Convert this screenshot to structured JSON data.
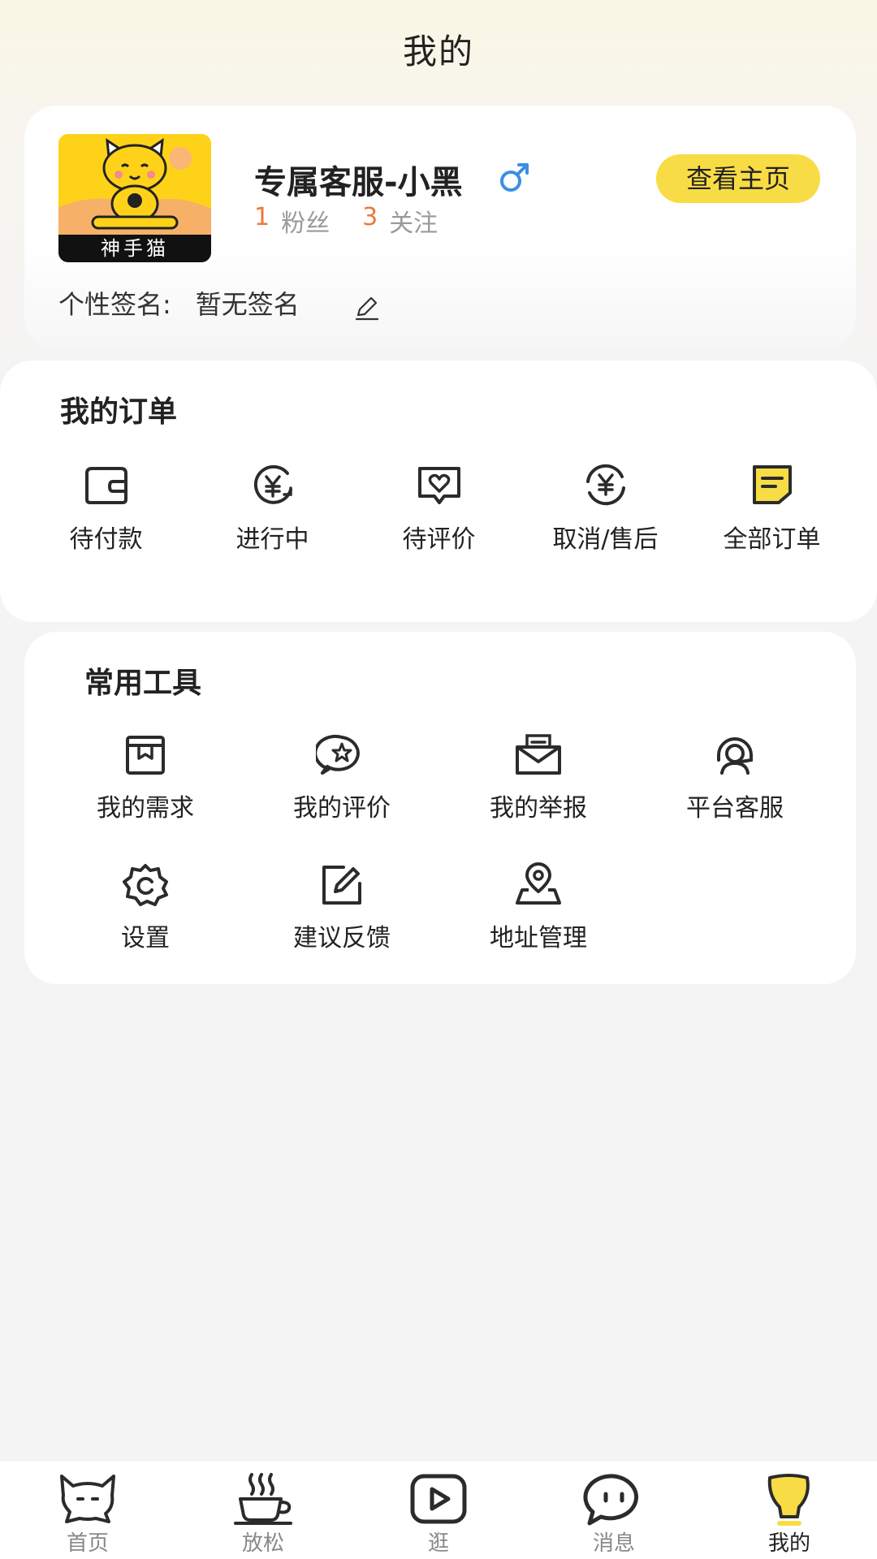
{
  "header": {
    "title": "我的"
  },
  "profile": {
    "avatar_caption": "神手猫",
    "nickname": "专属客服-小黑",
    "fans_count": "1",
    "fans_label": "粉丝",
    "follow_count": "3",
    "follow_label": "关注",
    "homepage_button": "查看主页",
    "signature_label": "个性签名:",
    "signature_value": "暂无签名",
    "colors": {
      "accent": "#f8dc45",
      "count": "#e87a3c",
      "gender": "#3b8fe0"
    }
  },
  "orders": {
    "title": "我的订单",
    "items": [
      {
        "label": "待付款",
        "icon": "wallet-icon"
      },
      {
        "label": "进行中",
        "icon": "yuan-refresh-icon"
      },
      {
        "label": "待评价",
        "icon": "heart-chat-icon"
      },
      {
        "label": "取消/售后",
        "icon": "yuan-exchange-icon"
      },
      {
        "label": "全部订单",
        "icon": "order-list-icon"
      }
    ]
  },
  "tools": {
    "title": "常用工具",
    "items": [
      {
        "label": "我的需求",
        "icon": "archive-box-icon"
      },
      {
        "label": "我的评价",
        "icon": "star-chat-icon"
      },
      {
        "label": "我的举报",
        "icon": "envelope-icon"
      },
      {
        "label": "平台客服",
        "icon": "headset-icon"
      },
      {
        "label": "设置",
        "icon": "gear-icon"
      },
      {
        "label": "建议反馈",
        "icon": "edit-square-icon"
      },
      {
        "label": "地址管理",
        "icon": "map-pin-icon"
      }
    ]
  },
  "tabbar": {
    "items": [
      {
        "label": "首页",
        "icon": "cat-icon",
        "active": false
      },
      {
        "label": "放松",
        "icon": "coffee-cup-icon",
        "active": false
      },
      {
        "label": "逛",
        "icon": "play-icon",
        "active": false
      },
      {
        "label": "消息",
        "icon": "chat-bubble-icon",
        "active": false
      },
      {
        "label": "我的",
        "icon": "profile-icon",
        "active": true
      }
    ]
  }
}
